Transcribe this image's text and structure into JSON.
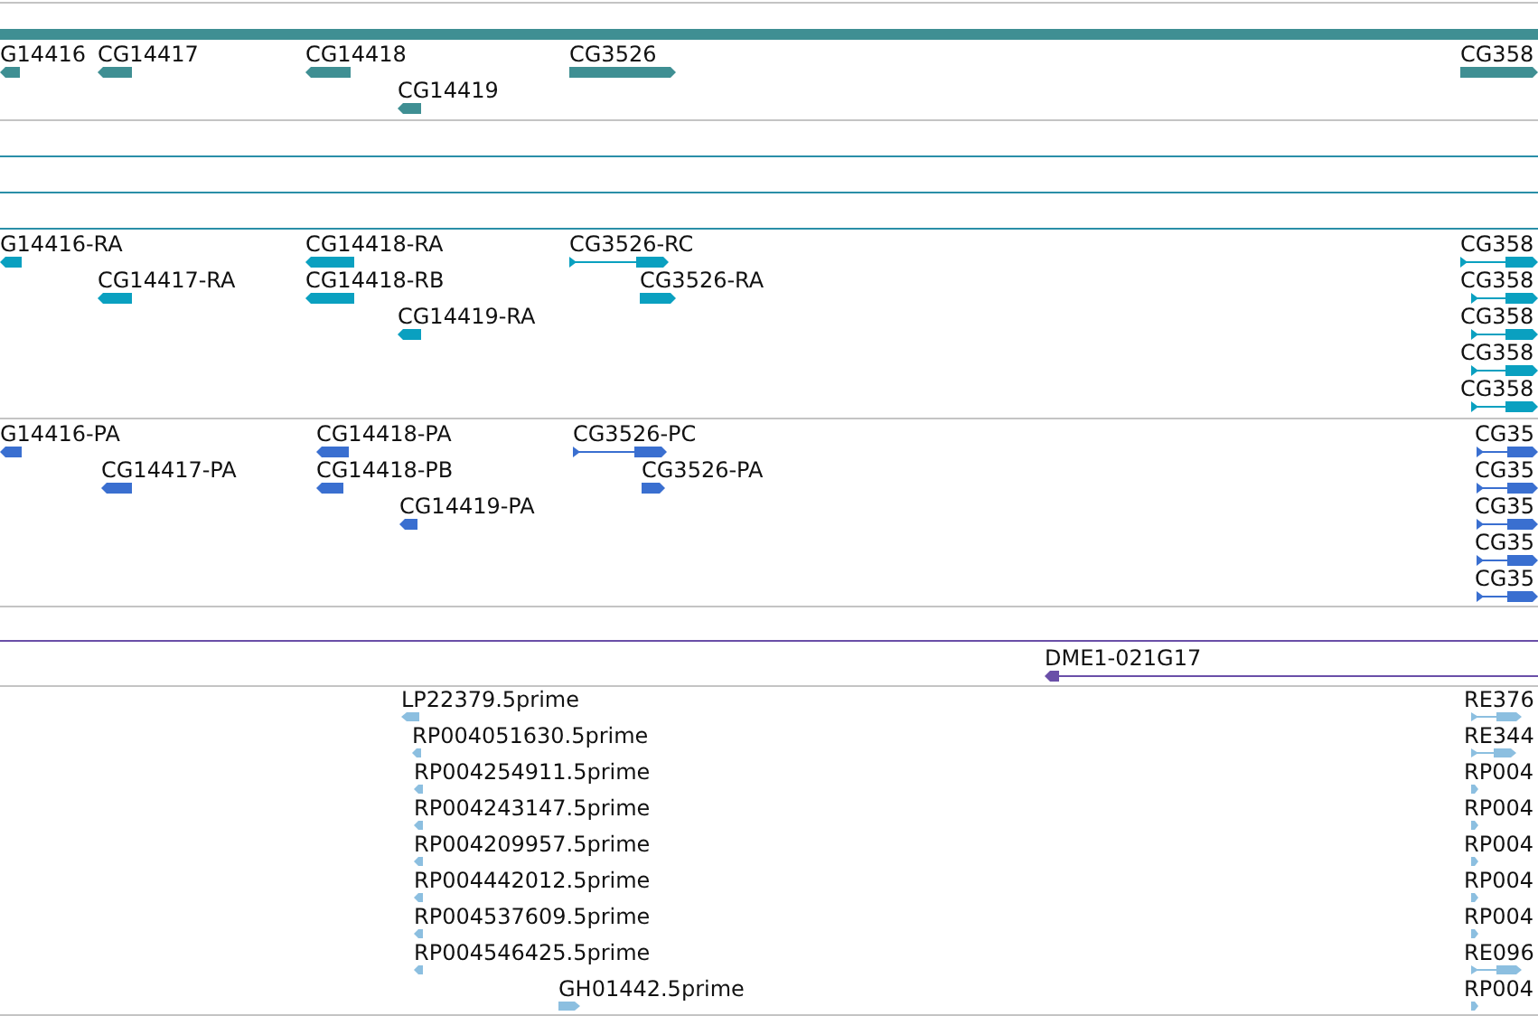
{
  "tracks": [
    {
      "kind": "genes",
      "color": "#3f8f93",
      "features": [
        {
          "label": "G14416",
          "reverse": true,
          "kind": "block"
        },
        {
          "label": "CG14417",
          "reverse": true,
          "kind": "block"
        },
        {
          "label": "CG14418",
          "reverse": true,
          "kind": "block"
        },
        {
          "label": "CG14419",
          "reverse": true,
          "kind": "block"
        },
        {
          "label": "CG3526",
          "reverse": false,
          "kind": "block"
        },
        {
          "label": "CG358",
          "reverse": false,
          "kind": "block"
        }
      ]
    },
    {
      "kind": "empty"
    },
    {
      "kind": "empty"
    },
    {
      "kind": "empty"
    },
    {
      "kind": "transcripts",
      "color": "#0aa0c0",
      "features": [
        {
          "label": "G14416-RA",
          "reverse": true,
          "kind": "block"
        },
        {
          "label": "CG14417-RA",
          "reverse": true,
          "kind": "block"
        },
        {
          "label": "CG14418-RA",
          "reverse": true,
          "kind": "block"
        },
        {
          "label": "CG14418-RB",
          "reverse": true,
          "kind": "block"
        },
        {
          "label": "CG14419-RA",
          "reverse": true,
          "kind": "block"
        },
        {
          "label": "CG3526-RC",
          "reverse": false,
          "kind": "spliced"
        },
        {
          "label": "CG3526-RA",
          "reverse": false,
          "kind": "block"
        },
        {
          "label": "CG358",
          "reverse": false,
          "kind": "spliced"
        },
        {
          "label": "CG358",
          "reverse": false,
          "kind": "spliced"
        },
        {
          "label": "CG358",
          "reverse": false,
          "kind": "spliced"
        },
        {
          "label": "CG358",
          "reverse": false,
          "kind": "spliced"
        },
        {
          "label": "CG358",
          "reverse": false,
          "kind": "spliced"
        }
      ]
    },
    {
      "kind": "proteins",
      "color": "#3a6fd0",
      "features": [
        {
          "label": "G14416-PA",
          "reverse": true,
          "kind": "block"
        },
        {
          "label": "CG14417-PA",
          "reverse": true,
          "kind": "block"
        },
        {
          "label": "CG14418-PA",
          "reverse": true,
          "kind": "block"
        },
        {
          "label": "CG14418-PB",
          "reverse": true,
          "kind": "block"
        },
        {
          "label": "CG14419-PA",
          "reverse": true,
          "kind": "block"
        },
        {
          "label": "CG3526-PC",
          "reverse": false,
          "kind": "spliced"
        },
        {
          "label": "CG3526-PA",
          "reverse": false,
          "kind": "block"
        },
        {
          "label": "CG35",
          "reverse": false,
          "kind": "spliced"
        },
        {
          "label": "CG35",
          "reverse": false,
          "kind": "spliced"
        },
        {
          "label": "CG35",
          "reverse": false,
          "kind": "spliced"
        },
        {
          "label": "CG35",
          "reverse": false,
          "kind": "spliced"
        },
        {
          "label": "CG35",
          "reverse": false,
          "kind": "spliced"
        }
      ]
    },
    {
      "kind": "empty"
    },
    {
      "kind": "clones",
      "color": "#6a4fa8",
      "features": [
        {
          "label": "DME1-021G17",
          "reverse": true,
          "kind": "spliced"
        }
      ]
    },
    {
      "kind": "ests",
      "color": "#8cbfe0",
      "features": [
        {
          "label": "LP22379.5prime",
          "reverse": true,
          "kind": "block"
        },
        {
          "label": "RP004051630.5prime",
          "reverse": true,
          "kind": "block"
        },
        {
          "label": "RP004254911.5prime",
          "reverse": true,
          "kind": "block"
        },
        {
          "label": "RP004243147.5prime",
          "reverse": true,
          "kind": "block"
        },
        {
          "label": "RP004209957.5prime",
          "reverse": true,
          "kind": "block"
        },
        {
          "label": "RP004442012.5prime",
          "reverse": true,
          "kind": "block"
        },
        {
          "label": "RP004537609.5prime",
          "reverse": true,
          "kind": "block"
        },
        {
          "label": "RP004546425.5prime",
          "reverse": true,
          "kind": "block"
        },
        {
          "label": "GH01442.5prime",
          "reverse": false,
          "kind": "block"
        },
        {
          "label": "RE376",
          "reverse": false,
          "kind": "spliced"
        },
        {
          "label": "RE344",
          "reverse": false,
          "kind": "spliced"
        },
        {
          "label": "RP004",
          "reverse": false,
          "kind": "block"
        },
        {
          "label": "RP004",
          "reverse": false,
          "kind": "block"
        },
        {
          "label": "RP004",
          "reverse": false,
          "kind": "block"
        },
        {
          "label": "RP004",
          "reverse": false,
          "kind": "block"
        },
        {
          "label": "RP004",
          "reverse": false,
          "kind": "block"
        },
        {
          "label": "RE096",
          "reverse": false,
          "kind": "spliced"
        },
        {
          "label": "RP004",
          "reverse": false,
          "kind": "block"
        }
      ]
    }
  ]
}
